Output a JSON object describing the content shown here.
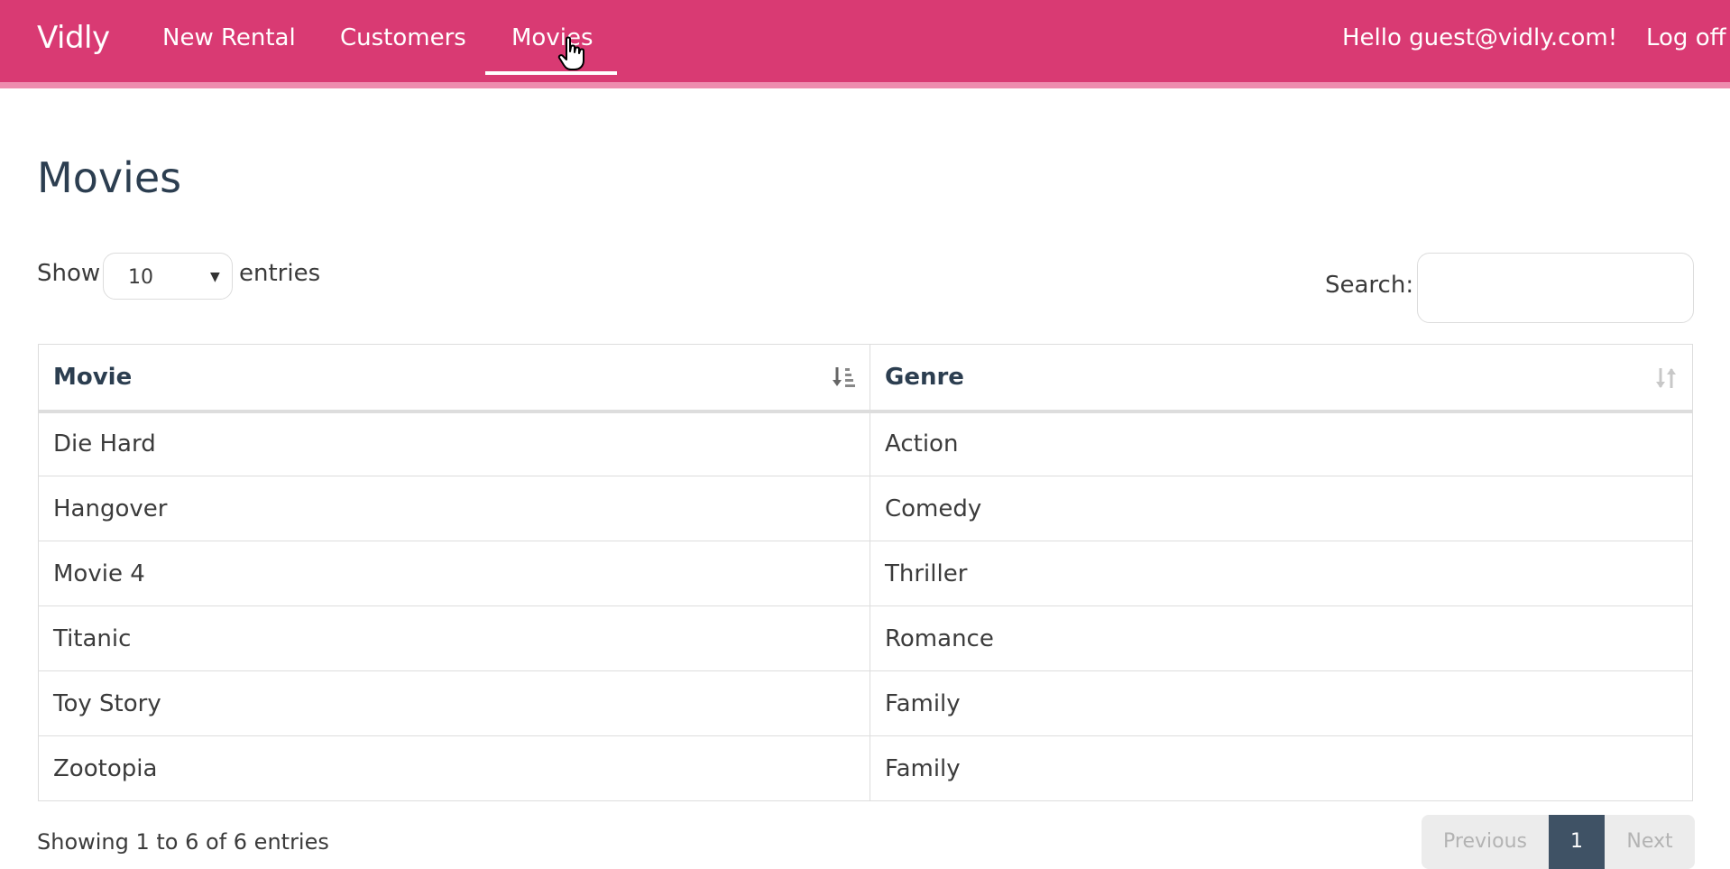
{
  "navbar": {
    "brand": "Vidly",
    "links": [
      {
        "label": "New Rental"
      },
      {
        "label": "Customers"
      },
      {
        "label": "Movies",
        "active": true
      }
    ],
    "greeting": "Hello guest@vidly.com!",
    "logoff": "Log off",
    "colors": {
      "background": "#d93a73",
      "stripe": "#ee8cae"
    }
  },
  "page": {
    "title": "Movies"
  },
  "length_control": {
    "show_label": "Show",
    "value": "10",
    "entries_label": "entries"
  },
  "search": {
    "label": "Search:",
    "value": "",
    "placeholder": ""
  },
  "table": {
    "columns": [
      {
        "label": "Movie",
        "sort": "ascending",
        "sort_icon": "sort-alpha-asc-icon"
      },
      {
        "label": "Genre",
        "sort": "none",
        "sort_icon": "sort-both-icon"
      }
    ],
    "rows": [
      {
        "movie": "Die Hard",
        "genre": "Action"
      },
      {
        "movie": "Hangover",
        "genre": "Comedy"
      },
      {
        "movie": "Movie 4",
        "genre": "Thriller"
      },
      {
        "movie": "Titanic",
        "genre": "Romance"
      },
      {
        "movie": "Toy Story",
        "genre": "Family"
      },
      {
        "movie": "Zootopia",
        "genre": "Family"
      }
    ]
  },
  "footer": {
    "info": "Showing 1 to 6 of 6 entries",
    "pagination": {
      "previous": "Previous",
      "current": "1",
      "next": "Next"
    }
  }
}
